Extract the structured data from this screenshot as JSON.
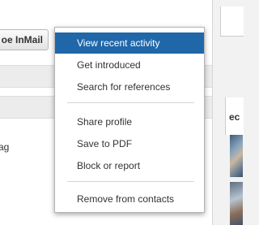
{
  "profile_actions": {
    "inmail_button_label": "oe InMail"
  },
  "content": {
    "snippet_text": "ag"
  },
  "sidebar": {
    "heading_fragment": "ec"
  },
  "dropdown": {
    "items": [
      {
        "label": "View recent activity",
        "highlighted": true
      },
      {
        "label": "Get introduced"
      },
      {
        "label": "Search for references"
      },
      {
        "label": "Share profile"
      },
      {
        "label": "Save to PDF"
      },
      {
        "label": "Block or report"
      },
      {
        "label": "Remove from contacts"
      }
    ]
  },
  "colors": {
    "highlight": "#1f67a8",
    "menu_text": "#333333",
    "highlight_text": "#ffffff"
  }
}
